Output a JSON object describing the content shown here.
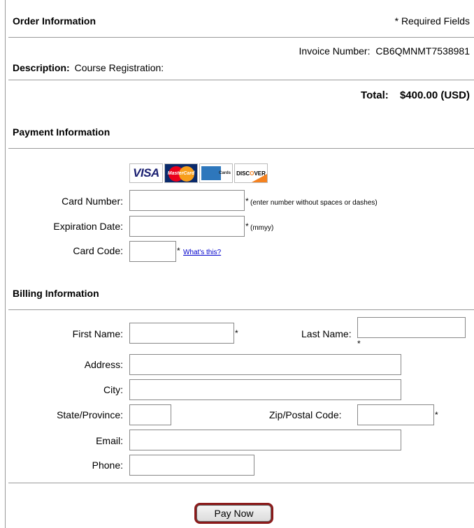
{
  "order": {
    "heading": "Order Information",
    "required_note": "* Required Fields",
    "invoice_label": "Invoice Number:",
    "invoice_value": "CB6QMNMT7538981",
    "description_label": "Description:",
    "description_value": "Course Registration:",
    "total_label": "Total:",
    "total_value": "$400.00 (USD)"
  },
  "payment": {
    "heading": "Payment Information",
    "card_logos": {
      "visa": "VISA",
      "mastercard": "MasterCard",
      "amex": "Cards",
      "discover_a": "DISC",
      "discover_o": "O",
      "discover_b": "VER"
    },
    "card_number_label": "Card Number:",
    "card_number_value": "",
    "card_number_hint": "(enter number without spaces or dashes)",
    "expiration_label": "Expiration Date:",
    "expiration_value": "",
    "expiration_hint": "(mmyy)",
    "card_code_label": "Card Code:",
    "card_code_value": "",
    "card_code_link": "What's this?",
    "required_mark": "*"
  },
  "billing": {
    "heading": "Billing Information",
    "first_name_label": "First Name:",
    "first_name_value": "",
    "last_name_label": "Last Name:",
    "last_name_value": "",
    "address_label": "Address:",
    "address_value": "",
    "city_label": "City:",
    "city_value": "",
    "state_label": "State/Province:",
    "state_value": "",
    "zip_label": "Zip/Postal Code:",
    "zip_value": "",
    "email_label": "Email:",
    "email_value": "",
    "phone_label": "Phone:",
    "phone_value": "",
    "required_mark": "*"
  },
  "actions": {
    "pay_now_label": "Pay Now",
    "highlight_color": "#8b1a1a"
  }
}
